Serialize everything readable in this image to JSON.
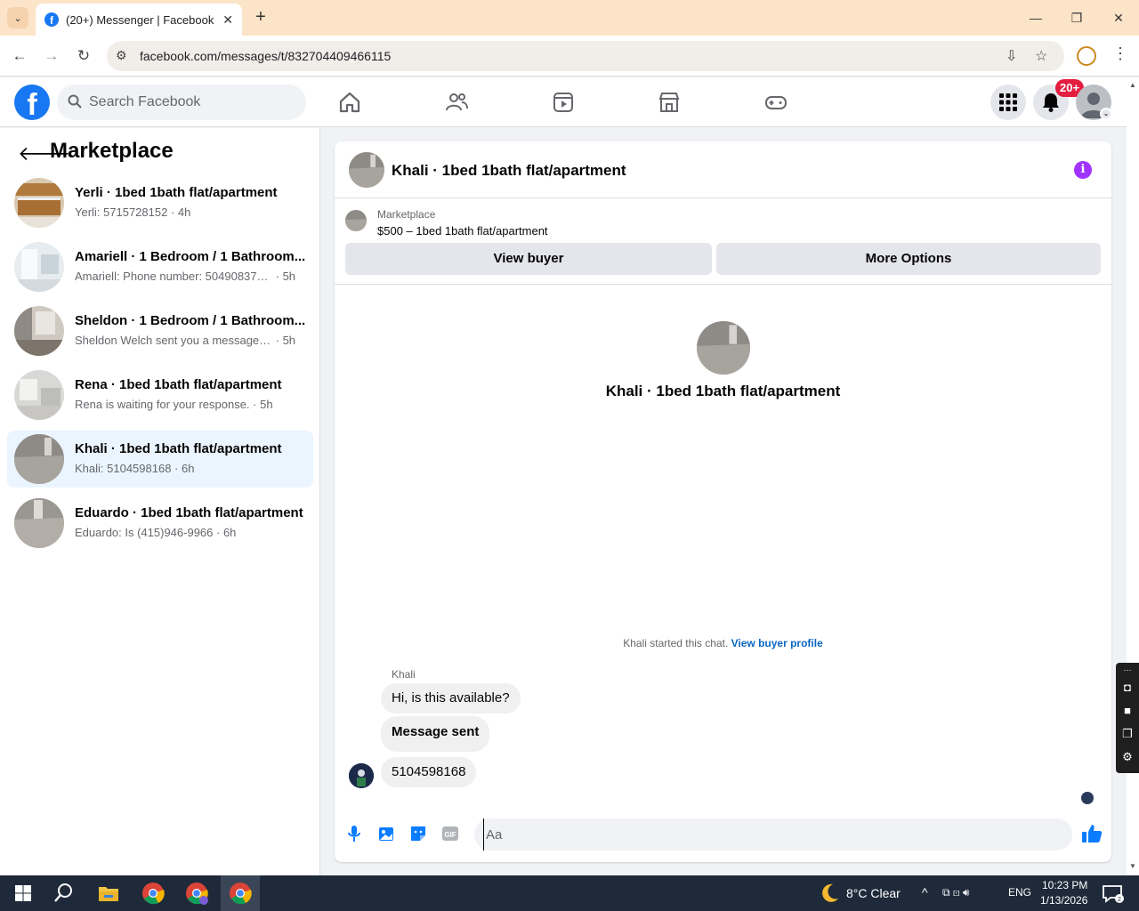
{
  "browser": {
    "tab_title": "(20+) Messenger | Facebook",
    "url": "facebook.com/messages/t/832704409466115",
    "tab_close": "✕",
    "new_tab": "+",
    "win_minimize": "—",
    "win_restore": "❐",
    "win_close": "✕"
  },
  "fb": {
    "logo_letter": "f",
    "search_placeholder": "Search Facebook",
    "notification_badge": "20+",
    "brand_color": "#1877f2"
  },
  "sidebar": {
    "title": "Marketplace",
    "conversations": [
      {
        "name": "Yerli · 1bed 1bath flat/apartment",
        "snippet": "Yerli: 5715728152",
        "time": "4h",
        "active": false
      },
      {
        "name": "Amariell · 1 Bedroom / 1 Bathroom...",
        "snippet": "Amariell: Phone number: 5049083793 ...",
        "time": "5h",
        "active": false
      },
      {
        "name": "Sheldon · 1 Bedroom / 1 Bathroom...",
        "snippet": "Sheldon Welch sent you a message a...",
        "time": "5h",
        "active": false
      },
      {
        "name": "Rena · 1bed 1bath flat/apartment",
        "snippet": "Rena is waiting for your response.",
        "time": "5h",
        "active": false
      },
      {
        "name": "Khali · 1bed 1bath flat/apartment",
        "snippet": "Khali: 5104598168",
        "time": "6h",
        "active": true
      },
      {
        "name": "Eduardo · 1bed 1bath flat/apartment",
        "snippet": "Eduardo: Is (415)946-9966",
        "time": "6h",
        "active": false
      }
    ]
  },
  "chat": {
    "title": "Khali · 1bed 1bath flat/apartment",
    "info_icon": "i",
    "listing_source": "Marketplace",
    "listing_price": "$500 – 1bed 1bath flat/apartment",
    "view_buyer": "View buyer",
    "more_options": "More Options",
    "intro_title": "Khali · 1bed 1bath flat/apartment",
    "started_text": "Khali started this chat. ",
    "view_profile": "View buyer profile",
    "sender_name": "Khali",
    "messages": [
      "Hi, is this available?",
      "Message sent",
      "5104598168"
    ],
    "composer_placeholder": "Aa",
    "gif_label": "GIF"
  },
  "taskbar": {
    "weather": "8°C  Clear",
    "lang": "ENG",
    "time": "10:23 PM",
    "date": "1/13/2026"
  }
}
